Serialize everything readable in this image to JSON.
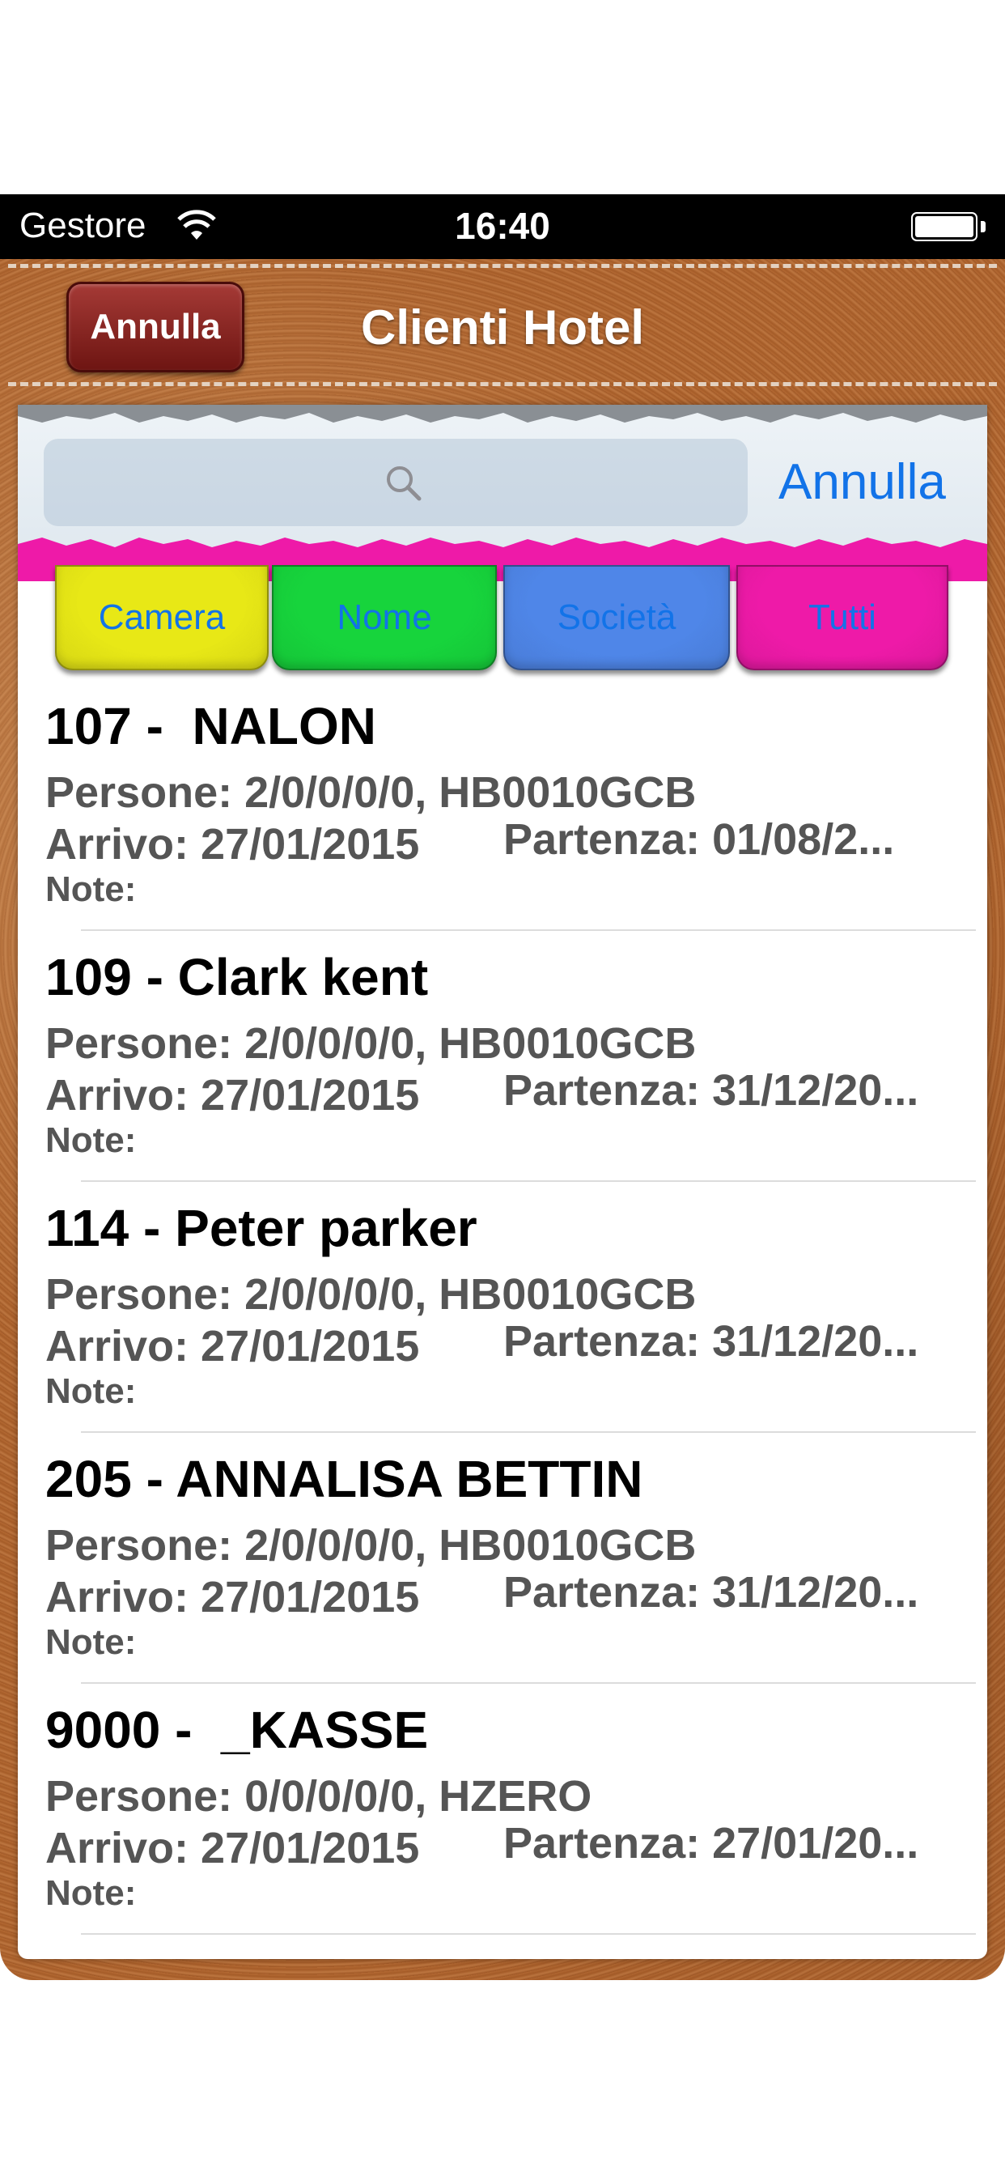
{
  "status_bar": {
    "carrier": "Gestore",
    "time": "16:40"
  },
  "header": {
    "back_button": "Annulla",
    "title": "Clienti Hotel"
  },
  "search": {
    "placeholder": "",
    "cancel_label": "Annulla"
  },
  "tabs": [
    {
      "label": "Camera",
      "color": "#e8e816"
    },
    {
      "label": "Nome",
      "color": "#17d43c"
    },
    {
      "label": "Società",
      "color": "#4f86e8"
    },
    {
      "label": "Tutti",
      "color": "#ee1aa8"
    }
  ],
  "clients": [
    {
      "title": "107 -  NALON",
      "persons": "Persone: 2/0/0/0/0, HB0010GCB",
      "arrival": "Arrivo: 27/01/2015",
      "departure": "Partenza: 01/08/2...",
      "note": "Note:"
    },
    {
      "title": "109 - Clark kent",
      "persons": "Persone: 2/0/0/0/0, HB0010GCB",
      "arrival": "Arrivo: 27/01/2015",
      "departure": "Partenza: 31/12/20...",
      "note": "Note:"
    },
    {
      "title": "114 - Peter parker",
      "persons": "Persone: 2/0/0/0/0, HB0010GCB",
      "arrival": "Arrivo: 27/01/2015",
      "departure": "Partenza: 31/12/20...",
      "note": "Note:"
    },
    {
      "title": "205 - ANNALISA BETTIN",
      "persons": "Persone: 2/0/0/0/0, HB0010GCB",
      "arrival": "Arrivo: 27/01/2015",
      "departure": "Partenza: 31/12/20...",
      "note": "Note:"
    },
    {
      "title": "9000 -  _KASSE",
      "persons": "Persone: 0/0/0/0/0, HZERO",
      "arrival": "Arrivo: 27/01/2015",
      "departure": "Partenza: 27/01/20...",
      "note": "Note:"
    }
  ],
  "colors": {
    "accent": "#1273e8",
    "leather": "#b06a34",
    "cancel_button": "#8a2420",
    "pink": "#ee1aa8"
  }
}
